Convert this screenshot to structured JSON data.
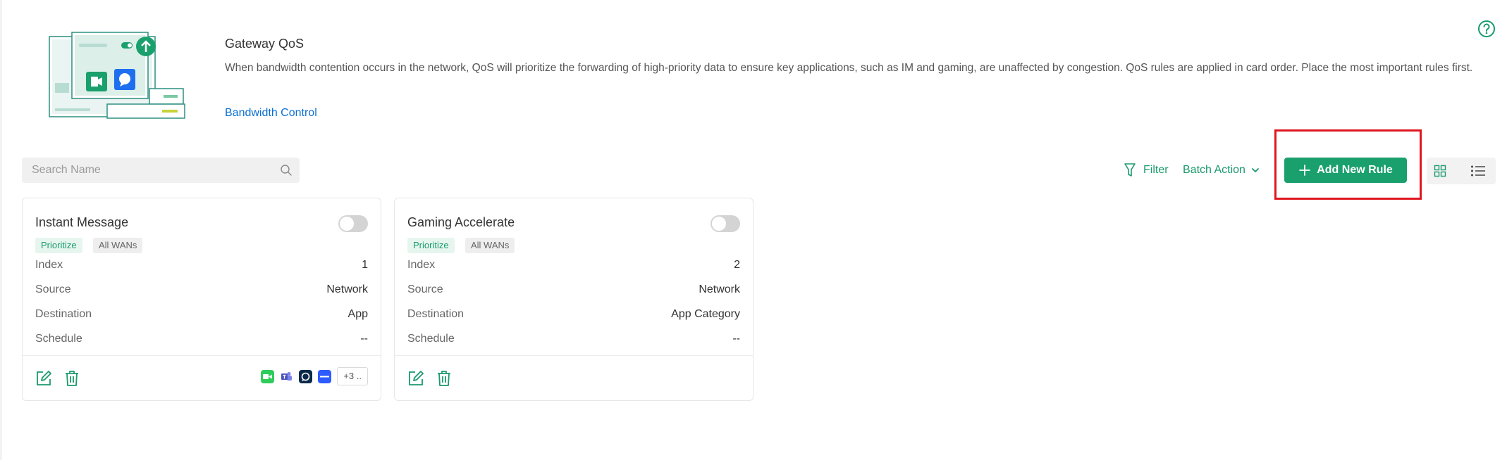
{
  "header": {
    "title": "Gateway QoS",
    "description": "When bandwidth contention occurs in the network, QoS will prioritize the forwarding of high-priority data to ensure key applications, such as IM and gaming, are unaffected by congestion. QoS rules are applied in card order. Place the most important rules first.",
    "link_label": "Bandwidth Control",
    "help_icon": "help-circle-icon"
  },
  "toolbar": {
    "search_placeholder": "Search Name",
    "filter_label": "Filter",
    "batch_action_label": "Batch Action",
    "add_rule_label": "Add New Rule",
    "accent_color": "#1aa06d",
    "highlight_color": "#e0161e"
  },
  "cards": [
    {
      "name": "Instant Message",
      "enabled": false,
      "tags": [
        "Prioritize",
        "All WANs"
      ],
      "rows": [
        {
          "label": "Index",
          "value": "1"
        },
        {
          "label": "Source",
          "value": "Network"
        },
        {
          "label": "Destination",
          "value": "App"
        },
        {
          "label": "Schedule",
          "value": "--"
        }
      ],
      "app_icons": [
        "facetime-icon",
        "teams-icon",
        "signal-icon",
        "zoom-icon"
      ],
      "more_label": "+3 .."
    },
    {
      "name": "Gaming Accelerate",
      "enabled": false,
      "tags": [
        "Prioritize",
        "All WANs"
      ],
      "rows": [
        {
          "label": "Index",
          "value": "2"
        },
        {
          "label": "Source",
          "value": "Network"
        },
        {
          "label": "Destination",
          "value": "App Category"
        },
        {
          "label": "Schedule",
          "value": "--"
        }
      ]
    }
  ]
}
